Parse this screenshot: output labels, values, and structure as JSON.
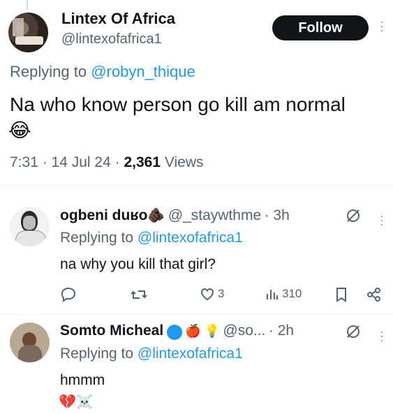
{
  "tweet": {
    "author_name": "Lintex Of Africa",
    "author_handle": "@lintexofafrica1",
    "follow_label": "Follow",
    "replying_prefix": "Replying to",
    "replying_handle": "@robyn_thique",
    "text": "Na who know person go kill am normal",
    "emoji": "😂",
    "time": "7:31",
    "date": "14 Jul 24",
    "views_count": "2,361",
    "views_label": "Views"
  },
  "replies": [
    {
      "name": "ogbeni duʁo",
      "name_emoji": "🫵🏿",
      "handle": "@_staywthme",
      "age": "3h",
      "replying_prefix": "Replying to",
      "replying_handle": "@lintexofafrica1",
      "text": "na why you kill that girl?",
      "likes": "3",
      "views": "310"
    },
    {
      "name": "Somto Micheal",
      "name_emojis": "🍎 💡",
      "handle": "@so...",
      "age": "2h",
      "replying_prefix": "Replying to",
      "replying_handle": "@lintexofafrica1",
      "text": "hmmm",
      "emojis": "💔☠️"
    }
  ],
  "colors": {
    "accent": "#1d9bf0",
    "muted": "#536471",
    "text": "#0f1419",
    "button": "#0f1419"
  }
}
